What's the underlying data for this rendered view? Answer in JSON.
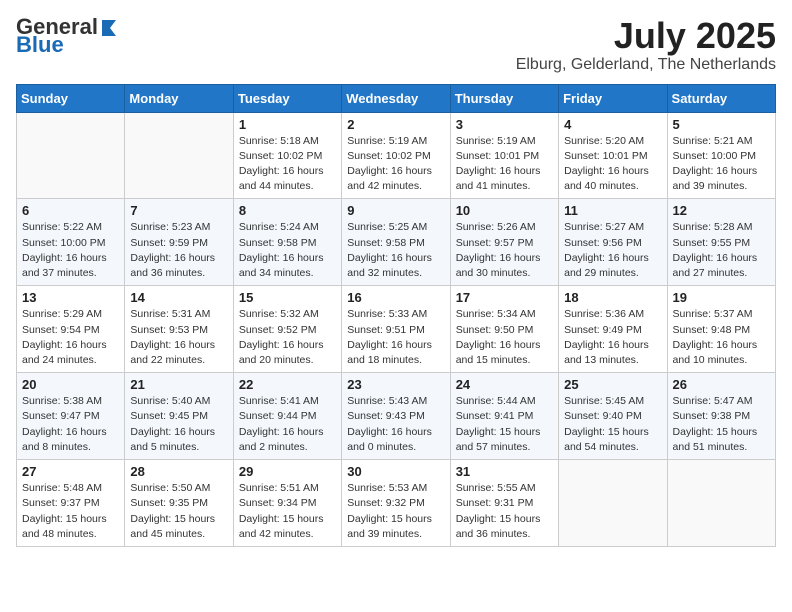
{
  "logo": {
    "general": "General",
    "blue": "Blue"
  },
  "title": {
    "month_year": "July 2025",
    "location": "Elburg, Gelderland, The Netherlands"
  },
  "days_of_week": [
    "Sunday",
    "Monday",
    "Tuesday",
    "Wednesday",
    "Thursday",
    "Friday",
    "Saturday"
  ],
  "weeks": [
    [
      {
        "day": "",
        "info": ""
      },
      {
        "day": "",
        "info": ""
      },
      {
        "day": "1",
        "info": "Sunrise: 5:18 AM\nSunset: 10:02 PM\nDaylight: 16 hours and 44 minutes."
      },
      {
        "day": "2",
        "info": "Sunrise: 5:19 AM\nSunset: 10:02 PM\nDaylight: 16 hours and 42 minutes."
      },
      {
        "day": "3",
        "info": "Sunrise: 5:19 AM\nSunset: 10:01 PM\nDaylight: 16 hours and 41 minutes."
      },
      {
        "day": "4",
        "info": "Sunrise: 5:20 AM\nSunset: 10:01 PM\nDaylight: 16 hours and 40 minutes."
      },
      {
        "day": "5",
        "info": "Sunrise: 5:21 AM\nSunset: 10:00 PM\nDaylight: 16 hours and 39 minutes."
      }
    ],
    [
      {
        "day": "6",
        "info": "Sunrise: 5:22 AM\nSunset: 10:00 PM\nDaylight: 16 hours and 37 minutes."
      },
      {
        "day": "7",
        "info": "Sunrise: 5:23 AM\nSunset: 9:59 PM\nDaylight: 16 hours and 36 minutes."
      },
      {
        "day": "8",
        "info": "Sunrise: 5:24 AM\nSunset: 9:58 PM\nDaylight: 16 hours and 34 minutes."
      },
      {
        "day": "9",
        "info": "Sunrise: 5:25 AM\nSunset: 9:58 PM\nDaylight: 16 hours and 32 minutes."
      },
      {
        "day": "10",
        "info": "Sunrise: 5:26 AM\nSunset: 9:57 PM\nDaylight: 16 hours and 30 minutes."
      },
      {
        "day": "11",
        "info": "Sunrise: 5:27 AM\nSunset: 9:56 PM\nDaylight: 16 hours and 29 minutes."
      },
      {
        "day": "12",
        "info": "Sunrise: 5:28 AM\nSunset: 9:55 PM\nDaylight: 16 hours and 27 minutes."
      }
    ],
    [
      {
        "day": "13",
        "info": "Sunrise: 5:29 AM\nSunset: 9:54 PM\nDaylight: 16 hours and 24 minutes."
      },
      {
        "day": "14",
        "info": "Sunrise: 5:31 AM\nSunset: 9:53 PM\nDaylight: 16 hours and 22 minutes."
      },
      {
        "day": "15",
        "info": "Sunrise: 5:32 AM\nSunset: 9:52 PM\nDaylight: 16 hours and 20 minutes."
      },
      {
        "day": "16",
        "info": "Sunrise: 5:33 AM\nSunset: 9:51 PM\nDaylight: 16 hours and 18 minutes."
      },
      {
        "day": "17",
        "info": "Sunrise: 5:34 AM\nSunset: 9:50 PM\nDaylight: 16 hours and 15 minutes."
      },
      {
        "day": "18",
        "info": "Sunrise: 5:36 AM\nSunset: 9:49 PM\nDaylight: 16 hours and 13 minutes."
      },
      {
        "day": "19",
        "info": "Sunrise: 5:37 AM\nSunset: 9:48 PM\nDaylight: 16 hours and 10 minutes."
      }
    ],
    [
      {
        "day": "20",
        "info": "Sunrise: 5:38 AM\nSunset: 9:47 PM\nDaylight: 16 hours and 8 minutes."
      },
      {
        "day": "21",
        "info": "Sunrise: 5:40 AM\nSunset: 9:45 PM\nDaylight: 16 hours and 5 minutes."
      },
      {
        "day": "22",
        "info": "Sunrise: 5:41 AM\nSunset: 9:44 PM\nDaylight: 16 hours and 2 minutes."
      },
      {
        "day": "23",
        "info": "Sunrise: 5:43 AM\nSunset: 9:43 PM\nDaylight: 16 hours and 0 minutes."
      },
      {
        "day": "24",
        "info": "Sunrise: 5:44 AM\nSunset: 9:41 PM\nDaylight: 15 hours and 57 minutes."
      },
      {
        "day": "25",
        "info": "Sunrise: 5:45 AM\nSunset: 9:40 PM\nDaylight: 15 hours and 54 minutes."
      },
      {
        "day": "26",
        "info": "Sunrise: 5:47 AM\nSunset: 9:38 PM\nDaylight: 15 hours and 51 minutes."
      }
    ],
    [
      {
        "day": "27",
        "info": "Sunrise: 5:48 AM\nSunset: 9:37 PM\nDaylight: 15 hours and 48 minutes."
      },
      {
        "day": "28",
        "info": "Sunrise: 5:50 AM\nSunset: 9:35 PM\nDaylight: 15 hours and 45 minutes."
      },
      {
        "day": "29",
        "info": "Sunrise: 5:51 AM\nSunset: 9:34 PM\nDaylight: 15 hours and 42 minutes."
      },
      {
        "day": "30",
        "info": "Sunrise: 5:53 AM\nSunset: 9:32 PM\nDaylight: 15 hours and 39 minutes."
      },
      {
        "day": "31",
        "info": "Sunrise: 5:55 AM\nSunset: 9:31 PM\nDaylight: 15 hours and 36 minutes."
      },
      {
        "day": "",
        "info": ""
      },
      {
        "day": "",
        "info": ""
      }
    ]
  ]
}
